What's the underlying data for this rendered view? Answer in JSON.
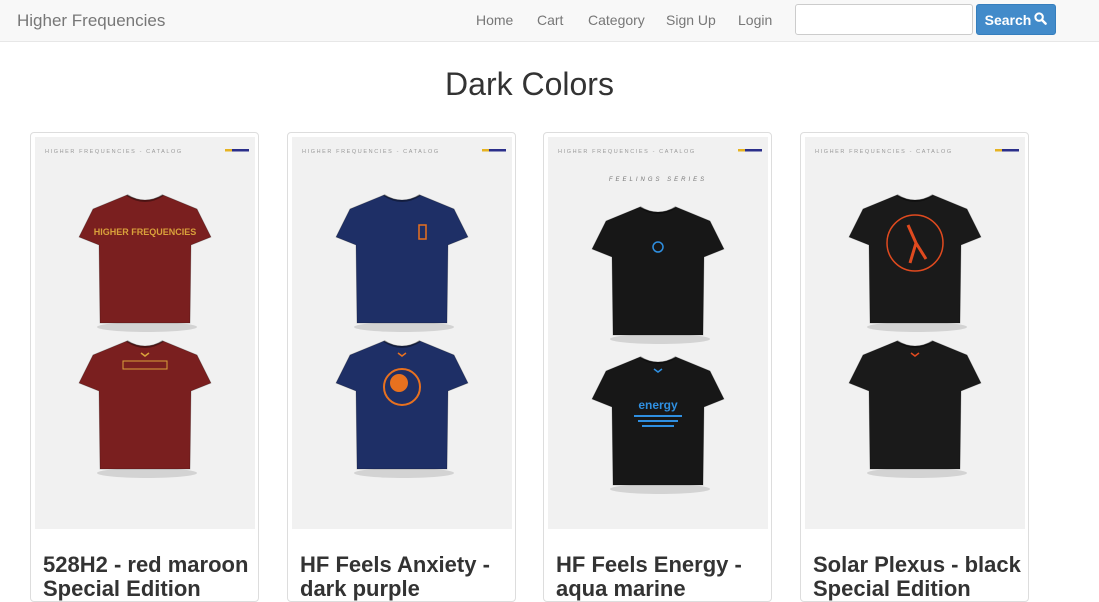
{
  "navbar": {
    "brand": "Higher Frequencies",
    "links": [
      "Home",
      "Cart",
      "Category",
      "Sign Up",
      "Login"
    ],
    "search_placeholder": "",
    "search_label": "Search"
  },
  "page": {
    "title": "Dark Colors"
  },
  "products": [
    {
      "title": "528H2 - red maroon Special Edition",
      "shirt_color": "#7a1f1f",
      "print_color": "#d9a13b",
      "front_print": "HIGHER FREQUENCIES",
      "series_label": "",
      "header_text": "HIGHER FREQUENCIES - CATALOG"
    },
    {
      "title": "HF Feels Anxiety - dark purple",
      "shirt_color": "#1e2f66",
      "print_color": "#e8711f",
      "front_print": "",
      "series_label": "",
      "header_text": "HIGHER FREQUENCIES - CATALOG"
    },
    {
      "title": "HF Feels Energy - aqua marine",
      "shirt_color": "#171717",
      "print_color": "#2f8fe0",
      "front_print": "energy",
      "series_label": "FEELINGS SERIES",
      "header_text": "HIGHER FREQUENCIES - CATALOG"
    },
    {
      "title": "Solar Plexus - black Special Edition",
      "shirt_color": "#1a1a1a",
      "print_color": "#e04a1f",
      "front_print": "",
      "series_label": "",
      "header_text": "HIGHER FREQUENCIES - CATALOG"
    }
  ]
}
